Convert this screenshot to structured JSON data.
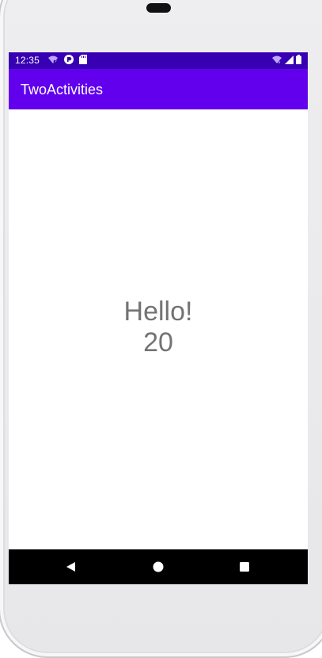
{
  "status_bar": {
    "time": "12:35",
    "left_icons": [
      "wifi-question-icon",
      "pocket-casts-icon",
      "sd-card-icon"
    ],
    "right_icons": [
      "wifi-off-icon",
      "signal-icon",
      "battery-icon"
    ],
    "background": "#3700b3"
  },
  "app_bar": {
    "title": "TwoActivities",
    "background": "#6200ee"
  },
  "main": {
    "message_label": "Hello!",
    "count_value": "20",
    "text_color": "#737373"
  },
  "navigation_bar": {
    "buttons": [
      "back-icon",
      "home-icon",
      "recent-apps-icon"
    ],
    "background": "#000000"
  }
}
